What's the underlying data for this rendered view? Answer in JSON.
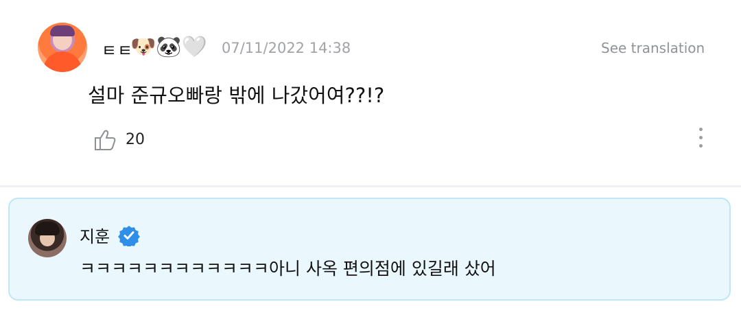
{
  "post": {
    "username": "ㅌㅌ",
    "username_emojis": "🐶🐼🤍",
    "timestamp": "07/11/2022 14:38",
    "see_translation": "See translation",
    "comment": "설마 준규오빠랑 밖에 나갔어여??!?",
    "like_count": "20",
    "like_icon": "thumbs-up-outline-icon",
    "more_icon": "vertical-ellipsis-icon"
  },
  "reply": {
    "author": "지훈",
    "verified_icon": "verified-badge-icon",
    "text": "ㅋㅋㅋㅋㅋㅋㅋㅋㅋㅋㅋㅋ아니 사옥 편의점에 있길래 샀어",
    "background_color": "#eaf7fd",
    "border_color": "#bfe6f6",
    "badge_color": "#2f8ee8"
  }
}
